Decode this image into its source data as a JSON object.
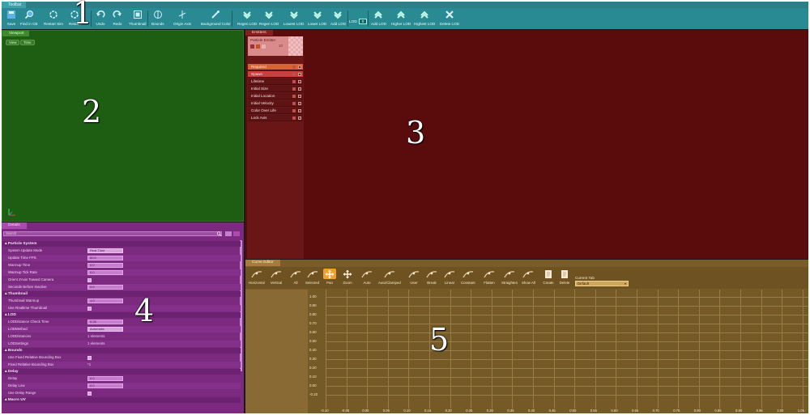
{
  "toolbar": {
    "tab": "Toolbar",
    "buttons": [
      {
        "label": "Save",
        "icon": "save-icon"
      },
      {
        "label": "Find in CB",
        "icon": "find-icon"
      },
      {
        "label": "Restart Sim",
        "icon": "restart-sim-icon"
      },
      {
        "label": "Restart",
        "icon": "restart-icon"
      },
      {
        "label": "Undo",
        "icon": "undo-icon"
      },
      {
        "label": "Redo",
        "icon": "redo-icon"
      },
      {
        "label": "Thumbnail",
        "icon": "thumbnail-icon"
      },
      {
        "label": "Bounds",
        "icon": "bounds-icon"
      },
      {
        "label": "Origin Axis",
        "icon": "origin-axis-icon"
      },
      {
        "label": "Background Color",
        "icon": "background-color-icon"
      },
      {
        "label": "Regen LOD",
        "icon": "regen-lod-icon"
      },
      {
        "label": "Regen LOD",
        "icon": "regen-lod-icon"
      },
      {
        "label": "Lowest LOD",
        "icon": "lowest-lod-icon"
      },
      {
        "label": "Lower LOD",
        "icon": "lower-lod-icon"
      },
      {
        "label": "Add LOD",
        "icon": "add-lod-icon"
      },
      {
        "label": "Add LOD",
        "icon": "add-lod-icon"
      },
      {
        "label": "Higher LOD",
        "icon": "higher-lod-icon"
      },
      {
        "label": "Highest LOD",
        "icon": "highest-lod-icon"
      },
      {
        "label": "Delete LOD",
        "icon": "delete-lod-icon"
      }
    ],
    "lod_label": "LOD",
    "lod_value": "0"
  },
  "viewport": {
    "tab": "Viewport",
    "buttons": [
      "View",
      "Time"
    ]
  },
  "emitters": {
    "tab": "Emitters",
    "emitter_name": "Particle Emitter",
    "emitter_count": "10",
    "modules": [
      {
        "label": "Required",
        "kind": "required"
      },
      {
        "label": "Spawn",
        "kind": "spawn"
      },
      {
        "label": "Lifetime",
        "kind": "plain"
      },
      {
        "label": "Initial Size",
        "kind": "plain"
      },
      {
        "label": "Initial Location",
        "kind": "plain"
      },
      {
        "label": "Initial Velocity",
        "kind": "plain"
      },
      {
        "label": "Color Over Life",
        "kind": "plain"
      },
      {
        "label": "Lock Axis",
        "kind": "plain"
      }
    ]
  },
  "details": {
    "tab": "Details",
    "search_placeholder": "Search",
    "sections": [
      {
        "title": "Particle System",
        "rows": [
          {
            "name": "System Update Mode",
            "type": "dropdown",
            "value": "Real-Time"
          },
          {
            "name": "Update Time FPS",
            "type": "input",
            "value": "60.0"
          },
          {
            "name": "Warmup Time",
            "type": "input",
            "value": "0.0"
          },
          {
            "name": "Warmup Tick Rate",
            "type": "input",
            "value": "0.0"
          },
          {
            "name": "Orient ZAxis Toward Camera",
            "type": "check",
            "value": ""
          },
          {
            "name": "Seconds Before Inactive",
            "type": "input",
            "value": "0.0"
          }
        ]
      },
      {
        "title": "Thumbnail",
        "rows": [
          {
            "name": "Thumbnail Warmup",
            "type": "input",
            "value": "1.0"
          },
          {
            "name": "Use Realtime Thumbnail",
            "type": "check",
            "value": ""
          }
        ]
      },
      {
        "title": "LOD",
        "rows": [
          {
            "name": "LODDistance Check Time",
            "type": "input",
            "value": "0.25"
          },
          {
            "name": "LODMethod",
            "type": "dropdown",
            "value": "Automatic"
          },
          {
            "name": "LODDistances",
            "type": "text",
            "value": "1 elements"
          },
          {
            "name": "LODSettings",
            "type": "text",
            "value": "1 elements"
          }
        ]
      },
      {
        "title": "Bounds",
        "rows": [
          {
            "name": "Use Fixed Relative Bounding Box",
            "type": "check",
            "value": ""
          },
          {
            "name": "Fixed Relative Bounding Box",
            "type": "text",
            "value": "*1"
          }
        ]
      },
      {
        "title": "Delay",
        "rows": [
          {
            "name": "Delay",
            "type": "input",
            "value": "0.0"
          },
          {
            "name": "Delay Low",
            "type": "input",
            "value": "0.0"
          },
          {
            "name": "Use Delay Range",
            "type": "check",
            "value": ""
          }
        ]
      },
      {
        "title": "Macro UV",
        "rows": []
      }
    ]
  },
  "curve_editor": {
    "tab": "Curve Editor",
    "buttons": [
      {
        "label": "Horizontal",
        "icon": "fit-horizontal-icon"
      },
      {
        "label": "Vertical",
        "icon": "fit-vertical-icon"
      },
      {
        "label": "All",
        "icon": "fit-all-icon"
      },
      {
        "label": "Selected",
        "icon": "fit-selected-icon"
      },
      {
        "label": "Pan",
        "icon": "pan-icon",
        "active": true
      },
      {
        "label": "Zoom",
        "icon": "zoom-icon"
      },
      {
        "label": "Auto",
        "icon": "auto-tangent-icon"
      },
      {
        "label": "Auto/Clamped",
        "icon": "auto-clamped-icon"
      },
      {
        "label": "User",
        "icon": "user-tangent-icon"
      },
      {
        "label": "Break",
        "icon": "break-tangent-icon"
      },
      {
        "label": "Linear",
        "icon": "linear-icon"
      },
      {
        "label": "Constant",
        "icon": "constant-icon"
      },
      {
        "label": "Flatten",
        "icon": "flatten-icon"
      },
      {
        "label": "Straighten",
        "icon": "straighten-icon"
      },
      {
        "label": "Show All",
        "icon": "show-all-icon"
      },
      {
        "label": "Create",
        "icon": "create-icon"
      },
      {
        "label": "Delete",
        "icon": "delete-icon"
      }
    ],
    "current_tab_label": "Current Tab",
    "current_tab_value": "Default",
    "y_ticks": [
      "1.00",
      "0.90",
      "0.80",
      "0.70",
      "0.60",
      "0.50",
      "0.40",
      "0.30",
      "0.20",
      "0.10",
      "0.00",
      "-0.10"
    ],
    "x_ticks": [
      "-0.10",
      "-0.05",
      "0.00",
      "0.05",
      "0.10",
      "0.15",
      "0.20",
      "0.25",
      "0.30",
      "0.35",
      "0.40",
      "0.45",
      "0.50",
      "0.55",
      "0.60",
      "0.65",
      "0.70",
      "0.75",
      "0.80",
      "0.85",
      "0.90",
      "0.95",
      "1.00",
      "1.05"
    ]
  },
  "callouts": [
    "1",
    "2",
    "3",
    "4",
    "5"
  ],
  "colors": {
    "toolbar": "#2a8a93",
    "viewport": "#1e5e12",
    "emitters": "#5a0c0c",
    "details": "#7b2a7f",
    "curve_editor": "#7a5c28"
  }
}
